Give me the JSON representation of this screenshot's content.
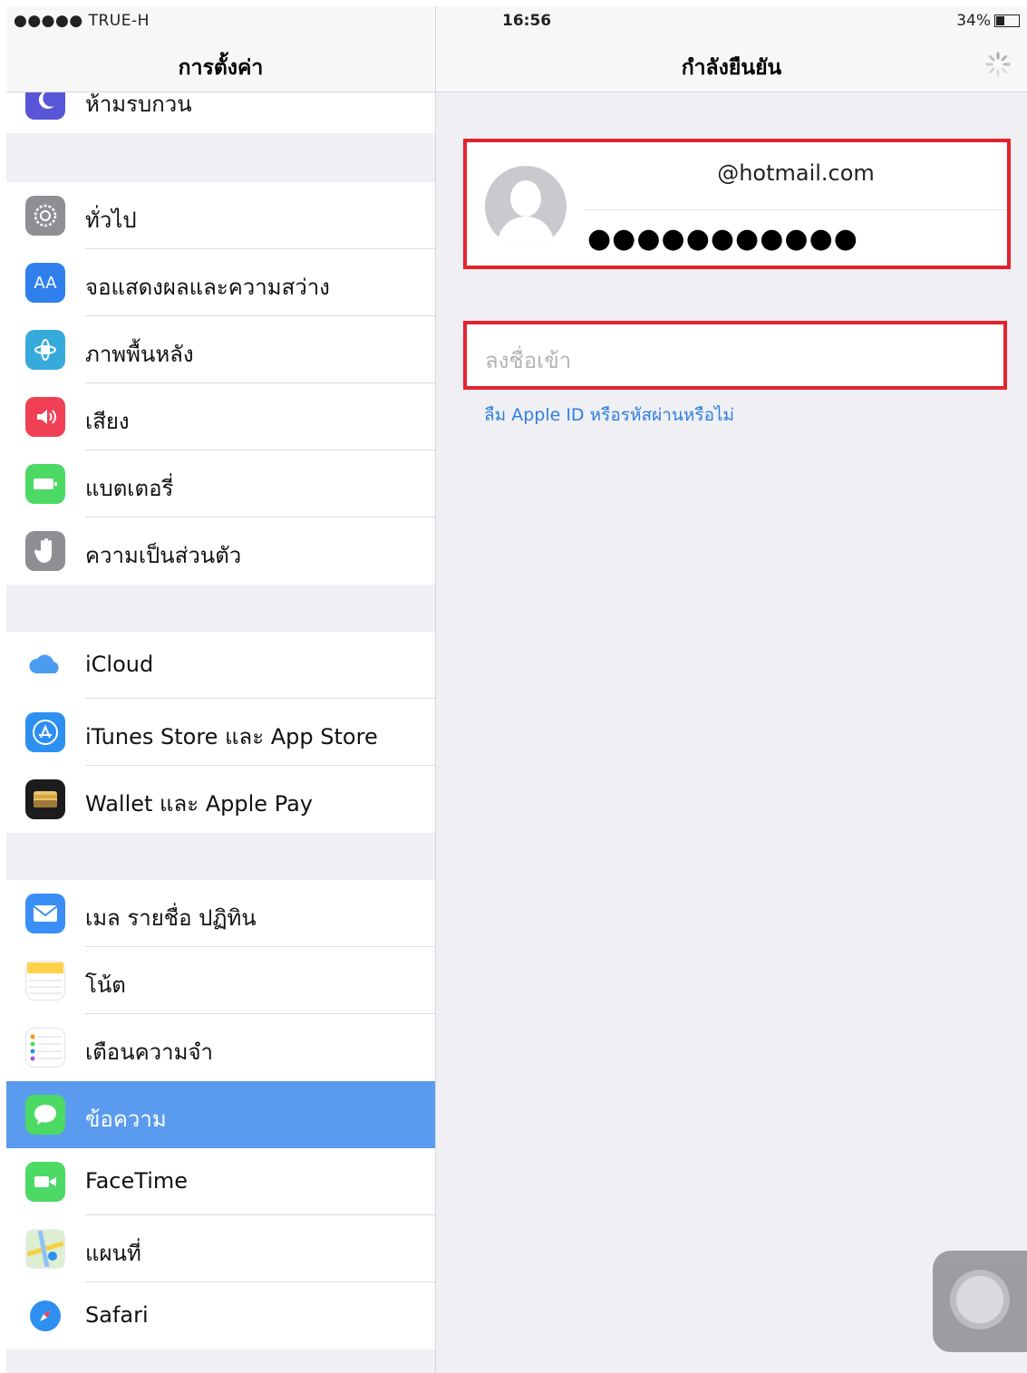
{
  "status_bar": {
    "carrier": "●●●●● TRUE-H",
    "time": "16:56",
    "battery": "34%"
  },
  "settings": {
    "title": "การตั้งค่า",
    "partial_item": {
      "label": "ห้ามรบกวน",
      "icon": "moon-icon",
      "color": "#5856d6"
    },
    "groups": [
      [
        {
          "label": "ทั่วไป",
          "icon": "gear-icon",
          "color": "#8e8e93"
        },
        {
          "label": "จอแสดงผลและความสว่าง",
          "icon": "display-aa-icon",
          "color": "#2f80ed"
        },
        {
          "label": "ภาพพื้นหลัง",
          "icon": "wallpaper-icon",
          "color": "#37aadc"
        },
        {
          "label": "เสียง",
          "icon": "speaker-icon",
          "color": "#f04055"
        },
        {
          "label": "แบตเตอรี่",
          "icon": "battery-icon",
          "color": "#4cd964"
        },
        {
          "label": "ความเป็นส่วนตัว",
          "icon": "hand-icon",
          "color": "#8e8e93"
        }
      ],
      [
        {
          "label": "iCloud",
          "icon": "cloud-icon",
          "color": "#ffffff"
        },
        {
          "label": "iTunes Store และ App Store",
          "icon": "app-store-icon",
          "color": "#2d8ff0"
        },
        {
          "label": "Wallet และ Apple Pay",
          "icon": "wallet-icon",
          "color": "#1c1c1e"
        }
      ],
      [
        {
          "label": "เมล รายชื่อ ปฏิทิน",
          "icon": "mail-icon",
          "color": "#3a8ef6"
        },
        {
          "label": "โน้ต",
          "icon": "notes-icon",
          "color": "#ffffff"
        },
        {
          "label": "เตือนความจำ",
          "icon": "reminders-icon",
          "color": "#ffffff"
        },
        {
          "label": "ข้อความ",
          "icon": "messages-icon",
          "color": "#4cd964",
          "selected": true
        },
        {
          "label": "FaceTime",
          "icon": "facetime-icon",
          "color": "#4cd964"
        },
        {
          "label": "แผนที่",
          "icon": "maps-icon",
          "color": "#e9e9ee"
        },
        {
          "label": "Safari",
          "icon": "safari-icon",
          "color": "#ffffff"
        }
      ]
    ]
  },
  "detail": {
    "title": "กำลังยืนยัน",
    "email": "@hotmail.com",
    "password_mask": "●●●●●●●●●●●",
    "signin_label": "ลงชื่อเข้า",
    "forgot_link": "ลืม Apple ID หรือรหัสผ่านหรือไม่"
  },
  "colors": {
    "highlight": "#e3232c",
    "selection": "#5a9bf0",
    "link": "#2f7fe0"
  }
}
